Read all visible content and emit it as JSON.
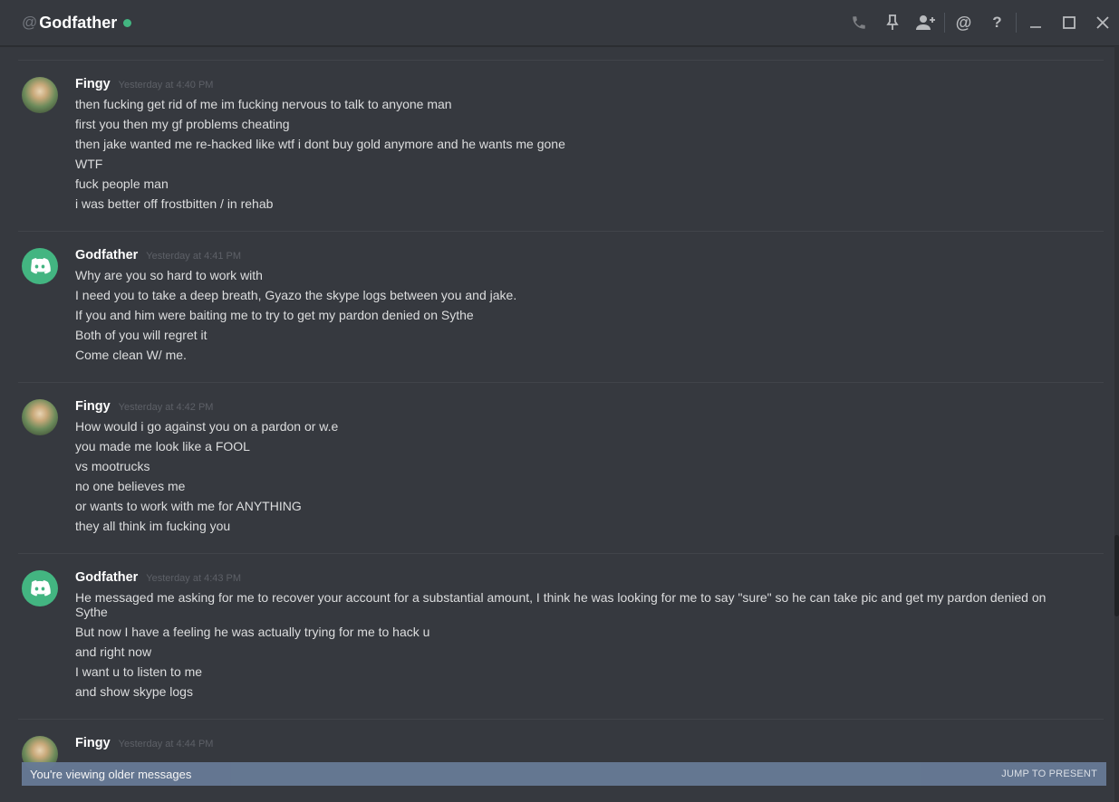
{
  "header": {
    "at": "@",
    "title": "Godfather",
    "status_color": "#43b581"
  },
  "toolbar": {
    "icons": [
      "phone-icon",
      "pin-icon",
      "add-friend-icon",
      "mention-icon",
      "help-icon",
      "minimize-icon",
      "maximize-icon",
      "close-icon"
    ],
    "help_label": "?",
    "mention_label": "@"
  },
  "messages": [
    {
      "author": "Fingy",
      "time": "Yesterday at 4:40 PM",
      "lines": [
        "then fucking get rid of me im fucking nervous to talk to anyone man",
        "first you then my gf problems cheating",
        "then jake wanted me re-hacked like wtf i dont buy gold anymore and he wants me gone",
        "WTF",
        "fuck people man",
        "i was better off frostbitten / in rehab"
      ]
    },
    {
      "author": "Godfather",
      "time": "Yesterday at 4:41 PM",
      "lines": [
        "Why are you so hard to work with",
        "I need you to take a deep breath, Gyazo the skype logs between you and jake.",
        "If you and him were baiting me to try to get my pardon denied on Sythe",
        "Both of you will regret it",
        "Come clean W/ me."
      ]
    },
    {
      "author": "Fingy",
      "time": "Yesterday at 4:42 PM",
      "lines": [
        "How would i go against you on a pardon or w.e",
        "you made me look like a FOOL",
        "vs mootrucks",
        "no one believes me",
        "or wants to work with me for ANYTHING",
        "they all think im fucking you"
      ]
    },
    {
      "author": "Godfather",
      "time": "Yesterday at 4:43 PM",
      "lines": [
        "He messaged me asking for me to recover your account for a substantial amount, I think he was looking for me to say \"sure\" so he can take pic and get my pardon denied on Sythe",
        "But now I have a feeling he was actually trying for me to hack u",
        "and right now",
        "I want u to listen to me",
        "and show skype logs"
      ]
    },
    {
      "author": "Fingy",
      "time": "Yesterday at 4:44 PM",
      "lines": []
    }
  ],
  "older_bar": {
    "text": "You're viewing older messages",
    "jump": "JUMP TO PRESENT"
  },
  "colors": {
    "background": "#36393f",
    "accent": "#43b581",
    "older_bar": "#677a96"
  }
}
